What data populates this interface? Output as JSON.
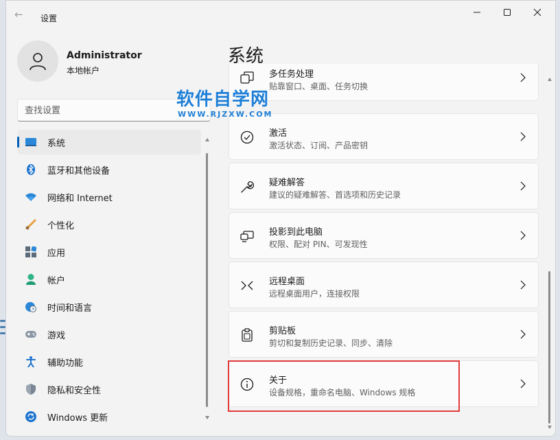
{
  "window": {
    "title": "设置",
    "back_glyph": "←"
  },
  "user": {
    "name": "Administrator",
    "account_type": "本地帐户"
  },
  "search": {
    "placeholder": "查找设置"
  },
  "sidebar": {
    "items": [
      {
        "label": "系统",
        "icon": "system-icon",
        "active": true
      },
      {
        "label": "蓝牙和其他设备",
        "icon": "bluetooth-icon"
      },
      {
        "label": "网络和 Internet",
        "icon": "wifi-icon"
      },
      {
        "label": "个性化",
        "icon": "brush-icon"
      },
      {
        "label": "应用",
        "icon": "apps-icon"
      },
      {
        "label": "帐户",
        "icon": "person-icon"
      },
      {
        "label": "时间和语言",
        "icon": "globe-clock-icon"
      },
      {
        "label": "游戏",
        "icon": "gamepad-icon"
      },
      {
        "label": "辅助功能",
        "icon": "accessibility-icon"
      },
      {
        "label": "隐私和安全性",
        "icon": "shield-icon"
      },
      {
        "label": "Windows 更新",
        "icon": "update-icon"
      }
    ]
  },
  "main": {
    "page_title": "系统",
    "cards": [
      {
        "title": "多任务处理",
        "subtitle": "贴靠窗口、桌面、任务切换",
        "icon": "multitasking-icon"
      },
      {
        "title": "激活",
        "subtitle": "激活状态、订阅、产品密钥",
        "icon": "check-circle-icon"
      },
      {
        "title": "疑难解答",
        "subtitle": "建议的疑难解答、首选项和历史记录",
        "icon": "wrench-icon"
      },
      {
        "title": "投影到此电脑",
        "subtitle": "权限、配对 PIN、可发现性",
        "icon": "projection-icon"
      },
      {
        "title": "远程桌面",
        "subtitle": "远程桌面用户，连接权限",
        "icon": "remote-desktop-icon"
      },
      {
        "title": "剪贴板",
        "subtitle": "剪切和复制历史记录、同步、清除",
        "icon": "clipboard-icon"
      },
      {
        "title": "关于",
        "subtitle": "设备规格，重命名电脑、Windows 规格",
        "icon": "info-icon"
      }
    ]
  },
  "watermark": {
    "main": "软件自学网",
    "sub": "WWW.RJZXW.COM"
  },
  "colors": {
    "accent": "#005fb8",
    "highlight": "#e03a3a",
    "watermark": "#1e7fd6"
  }
}
